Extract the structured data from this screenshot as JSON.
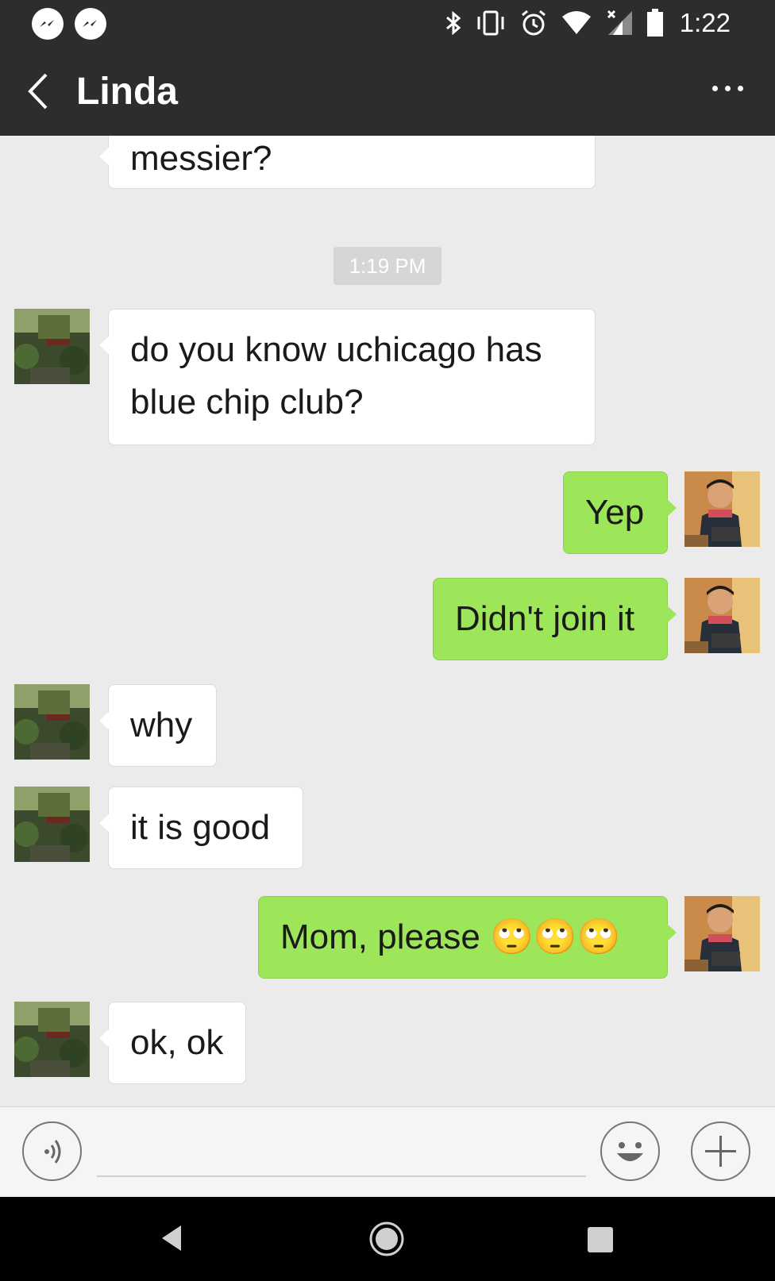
{
  "status_bar": {
    "time": "1:22",
    "icons": [
      "messenger-icon",
      "messenger-icon",
      "bluetooth-icon",
      "vibrate-icon",
      "alarm-icon",
      "wifi-icon",
      "signal-icon",
      "battery-icon"
    ]
  },
  "header": {
    "title": "Linda",
    "back_icon": "chevron-left-icon",
    "more_icon": "more-dots-icon"
  },
  "chat": {
    "timestamp": "1:19 PM",
    "messages": [
      {
        "sender": "Linda",
        "direction": "in",
        "text": "messier?"
      },
      {
        "sender": "Linda",
        "direction": "in",
        "text_line1": "do you know uchicago has",
        "text_line2": "blue chip club?"
      },
      {
        "sender": "me",
        "direction": "out",
        "text": "Yep"
      },
      {
        "sender": "me",
        "direction": "out",
        "text": "Didn't join it"
      },
      {
        "sender": "Linda",
        "direction": "in",
        "text": "why"
      },
      {
        "sender": "Linda",
        "direction": "in",
        "text": "it is good"
      },
      {
        "sender": "me",
        "direction": "out",
        "text": "Mom, please 🙄🙄🙄"
      },
      {
        "sender": "Linda",
        "direction": "in",
        "text": "ok, ok"
      }
    ]
  },
  "input_bar": {
    "voice_icon": "voice-icon",
    "input_value": "",
    "emoji_icon": "emoji-icon",
    "plus_icon": "plus-icon"
  },
  "nav_bar": {
    "icons": [
      "nav-back-icon",
      "nav-home-icon",
      "nav-recent-icon"
    ]
  },
  "colors": {
    "header_bg": "#2d2d2d",
    "chat_bg": "#ebebeb",
    "outgoing_bubble": "#9ee659",
    "incoming_bubble": "#ffffff"
  }
}
